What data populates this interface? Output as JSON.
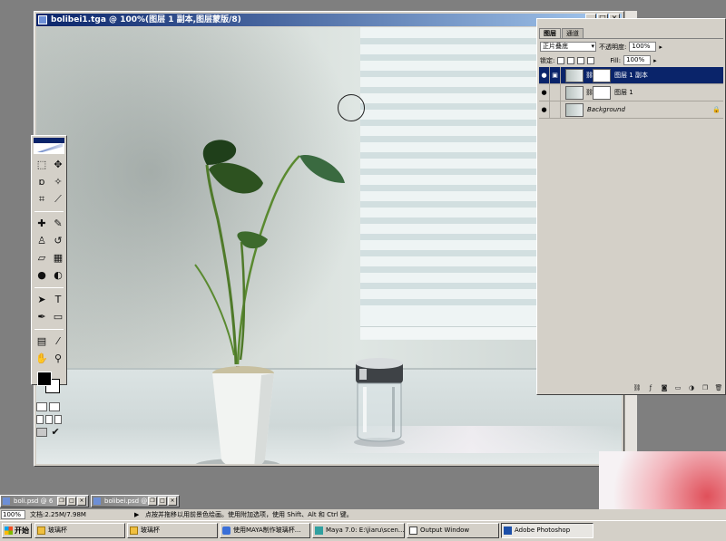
{
  "document": {
    "title": "bolibei1.tga @ 100%(图层 1 副本,图层蒙版/8)",
    "controls": [
      "_",
      "□",
      "×"
    ]
  },
  "toolbox": {
    "tools": [
      {
        "name": "marquee-tool",
        "glyph": "⬚"
      },
      {
        "name": "move-tool",
        "glyph": "✥"
      },
      {
        "name": "lasso-tool",
        "glyph": "ɒ"
      },
      {
        "name": "magic-wand-tool",
        "glyph": "✧"
      },
      {
        "name": "crop-tool",
        "glyph": "⌗"
      },
      {
        "name": "slice-tool",
        "glyph": "⟋"
      },
      {
        "name": "healing-brush-tool",
        "glyph": "✚"
      },
      {
        "name": "brush-tool",
        "glyph": "✎"
      },
      {
        "name": "clone-stamp-tool",
        "glyph": "♙"
      },
      {
        "name": "history-brush-tool",
        "glyph": "↺"
      },
      {
        "name": "eraser-tool",
        "glyph": "▱"
      },
      {
        "name": "gradient-tool",
        "glyph": "▦"
      },
      {
        "name": "blur-tool",
        "glyph": "●"
      },
      {
        "name": "dodge-tool",
        "glyph": "◐"
      },
      {
        "name": "path-selection-tool",
        "glyph": "➤"
      },
      {
        "name": "type-tool",
        "glyph": "T"
      },
      {
        "name": "pen-tool",
        "glyph": "✒"
      },
      {
        "name": "shape-tool",
        "glyph": "▭"
      },
      {
        "name": "notes-tool",
        "glyph": "▤"
      },
      {
        "name": "eyedropper-tool",
        "glyph": "⁄"
      },
      {
        "name": "hand-tool",
        "glyph": "✋"
      },
      {
        "name": "zoom-tool",
        "glyph": "⚲"
      }
    ]
  },
  "layers_palette": {
    "tabs": [
      "图层",
      "通道"
    ],
    "blend_mode": "正片叠底",
    "opacity_label": "不透明度:",
    "opacity_value": "100%",
    "lock_label": "锁定:",
    "fill_label": "Fill:",
    "fill_value": "100%",
    "layers": [
      {
        "name": "图层 1 副本",
        "selected": true,
        "has_mask": true
      },
      {
        "name": "图层 1",
        "selected": false,
        "has_mask": true
      },
      {
        "name": "Background",
        "selected": false,
        "has_mask": false
      }
    ],
    "footer_icons": [
      "link-icon",
      "layer-style-icon",
      "add-mask-icon",
      "new-set-icon",
      "adjustment-layer-icon",
      "new-layer-icon",
      "trash-icon"
    ]
  },
  "minimized_docs": [
    {
      "title": "boli.psd @ 6"
    },
    {
      "title": "bolibei.psd @"
    }
  ],
  "status_bar": {
    "zoom": "100%",
    "doc_info": "文档:2.25M/7.98M",
    "hint": "点按并拖移以用前景色绘画。使用附加选项，使用 Shift、Alt 和 Ctrl 键。"
  },
  "taskbar": {
    "start_label": "开始",
    "items": [
      {
        "label": "玻璃杯",
        "icon": "folder-icon",
        "active": false
      },
      {
        "label": "玻璃杯",
        "icon": "folder-icon",
        "active": false
      },
      {
        "label": "使用MAYA制作玻璃杯...",
        "icon": "ie-icon",
        "active": false
      },
      {
        "label": "Maya 7.0: E:\\jiaru\\scen...",
        "icon": "maya-icon",
        "active": false
      },
      {
        "label": "Output Window",
        "icon": "out-icon",
        "active": false
      },
      {
        "label": "Adobe Photoshop",
        "icon": "ps-task-icon",
        "active": true
      }
    ]
  },
  "colors": {
    "titlebar": "#0a246a",
    "selected_layer": "#0a246a",
    "foreground": "#000000",
    "background": "#ffffff"
  }
}
